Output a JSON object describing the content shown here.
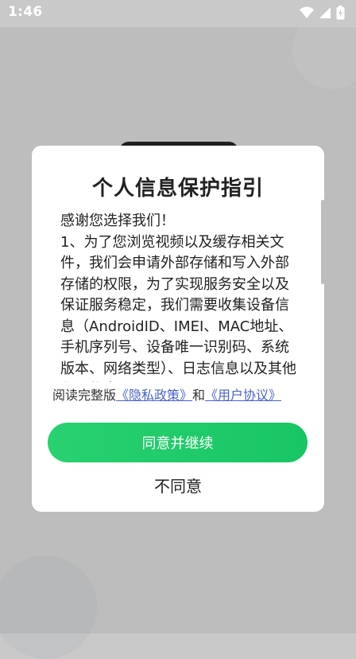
{
  "status_bar": {
    "time": "1:46",
    "icons": [
      "wifi-icon",
      "signal-icon",
      "battery-icon"
    ]
  },
  "dialog": {
    "title": "个人信息保护指引",
    "paragraphs": [
      "感谢您选择我们！",
      "1、为了您浏览视频以及缓存相关文件，我们会申请外部存储和写入外部存储的权限，为了实现服务安全以及保证服务稳定，我们需要收集设备信息（AndroidID、IMEI、MAC地址、手机序列号、设备唯一识别码、系统版本、网络类型）、日志信息以及其他必要信息。"
    ],
    "read_prefix": "阅读完整版",
    "privacy_link": "《隐私政策》",
    "connector": "和",
    "user_agreement_link": "《用户协议》",
    "agree_label": "同意并继续",
    "disagree_label": "不同意"
  },
  "colors": {
    "accent_green": "#1fc96a",
    "link_blue": "#4a63c8",
    "background_gray": "#c9c9c9"
  }
}
